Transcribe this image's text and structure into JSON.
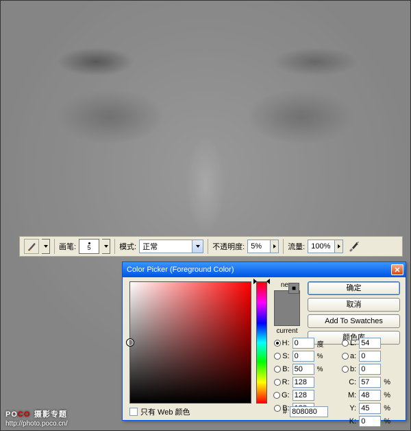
{
  "options_bar": {
    "brush_label": "画笔:",
    "brush_size": "5",
    "mode_label": "模式:",
    "mode_value": "正常",
    "opacity_label": "不透明度:",
    "opacity_value": "5%",
    "flow_label": "流量:",
    "flow_value": "100%"
  },
  "color_picker": {
    "title": "Color Picker (Foreground Color)",
    "new_label": "new",
    "current_label": "current",
    "new_color": "#808080",
    "current_color": "#808080",
    "buttons": {
      "ok": "确定",
      "cancel": "取消",
      "add_swatches": "Add To Swatches",
      "color_lib": "颜色库"
    },
    "hsb": {
      "H_label": "H:",
      "H": "0",
      "H_unit": "度",
      "S_label": "S:",
      "S": "0",
      "S_unit": "%",
      "B_label": "B:",
      "B": "50",
      "B_unit": "%"
    },
    "rgb": {
      "R_label": "R:",
      "R": "128",
      "G_label": "G:",
      "G": "128",
      "Bv_label": "B:",
      "Bv": "128"
    },
    "lab": {
      "L_label": "L:",
      "L": "54",
      "a_label": "a:",
      "a": "0",
      "b_label": "b:",
      "b": "0"
    },
    "cmyk": {
      "C_label": "C:",
      "C": "57",
      "C_unit": "%",
      "M_label": "M:",
      "M": "48",
      "M_unit": "%",
      "Y_label": "Y:",
      "Y": "45",
      "Y_unit": "%",
      "K_label": "K:",
      "K": "0",
      "K_unit": "%"
    },
    "hex_label": "#",
    "hex": "808080",
    "web_only_label": "只有 Web 颜色",
    "selected_channel": "H",
    "hue_pos_pct": 0,
    "sv_x_pct": 0,
    "sv_y_pct": 50
  },
  "watermark": {
    "brand_prefix": "PO",
    "brand_suffix": "CO",
    "topic": "摄影专题",
    "url": "http://photo.poco.cn/"
  }
}
